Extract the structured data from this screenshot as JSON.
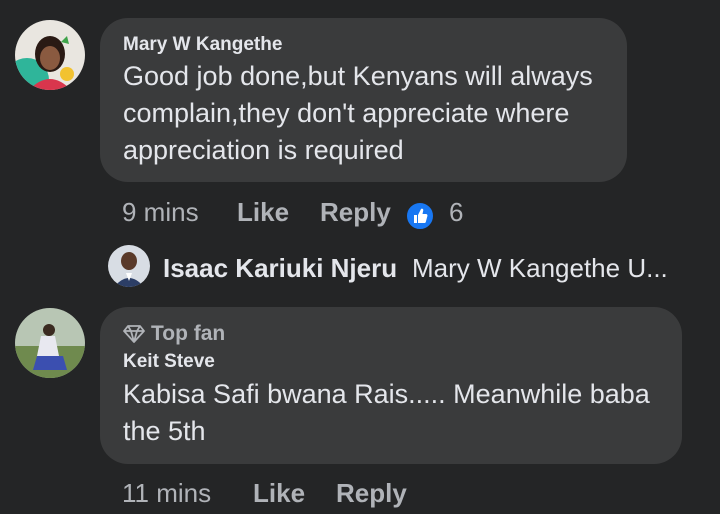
{
  "comments": [
    {
      "author": "Mary W Kangethe",
      "text_line1": "Good job done,but Kenyans will always",
      "text_line2": "complain,they don't appreciate where",
      "text_line3": "appreciation is required",
      "time": "9 mins",
      "like_label": "Like",
      "reply_label": "Reply",
      "reaction_count": "6",
      "reaction_icon": "thumbs-up-icon"
    },
    {
      "badge": "Top fan",
      "badge_icon": "diamond-icon",
      "author": "Keit Steve",
      "text_line1": "Kabisa Safi bwana Rais..... Meanwhile baba",
      "text_line2": "the 5th",
      "time": "11 mins",
      "like_label": "Like",
      "reply_label": "Reply"
    }
  ],
  "reply_preview": {
    "author": "Isaac Kariuki Njeru",
    "text": "Mary W Kangethe U..."
  },
  "colors": {
    "background": "#242526",
    "bubble": "#3a3b3c",
    "primary_text": "#e4e6eb",
    "secondary_text": "#b0b3b8",
    "like_blue": "#1877f2"
  }
}
